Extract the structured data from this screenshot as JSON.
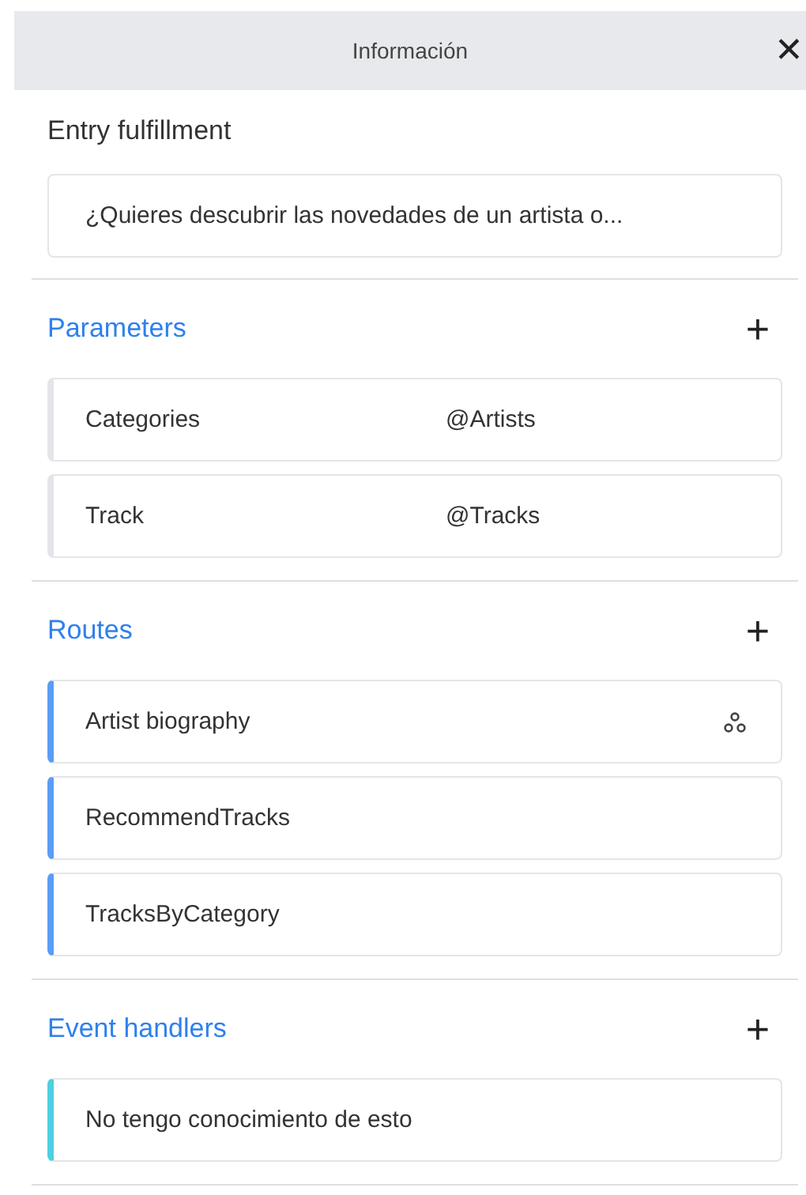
{
  "header": {
    "title": "Información",
    "close": "✕"
  },
  "entry": {
    "label": "Entry fulfillment",
    "text": "¿Quieres descubrir las novedades de un artista o..."
  },
  "sections": [
    {
      "title": "Parameters",
      "add": "+",
      "items": [
        {
          "kind": "param",
          "name": "Categories",
          "value": "@Artists",
          "color": "#e4e5e8"
        },
        {
          "kind": "param",
          "name": "Track",
          "value": "@Tracks",
          "color": "#e4e5e8"
        }
      ]
    },
    {
      "title": "Routes",
      "add": "+",
      "items": [
        {
          "kind": "route",
          "name": "Artist biography",
          "flow_icon": true,
          "color": "#5b9cf6"
        },
        {
          "kind": "route",
          "name": "RecommendTracks",
          "flow_icon": false,
          "color": "#5b9cf6"
        },
        {
          "kind": "route",
          "name": "TracksByCategory",
          "flow_icon": false,
          "color": "#5b9cf6"
        }
      ]
    },
    {
      "title": "Event handlers",
      "add": "+",
      "items": [
        {
          "kind": "route",
          "name": "No tengo conocimiento de esto",
          "flow_icon": false,
          "color": "#4dd0e1"
        }
      ]
    }
  ]
}
